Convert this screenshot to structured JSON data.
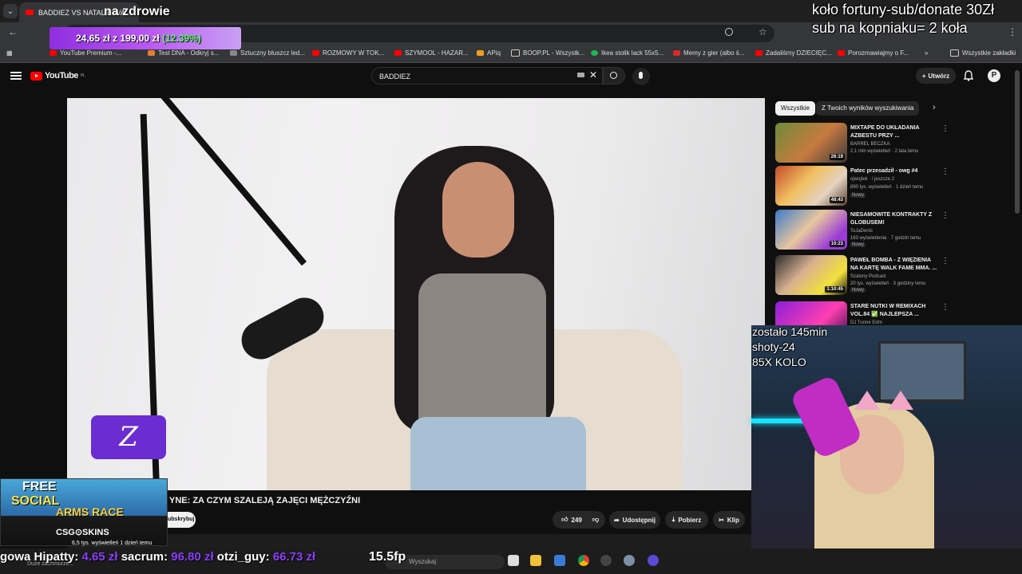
{
  "browser": {
    "tab_title": "BADDIEZ VS NATALIE WAKOWSKA - YouTube",
    "tab_visible": "BADDIEZ VS NATALIE WA",
    "bookmarks": [
      "YouTube Premium -...",
      "Test DNA - Odkryj s...",
      "Sztuczny bluszcz led...",
      "ROZMOWY W TOK...",
      "SZYMOOL - HAZAR...",
      "APiq",
      "BOOP.PL - Wszystk...",
      "Ikea stolik lack 55x5...",
      "Memy z gier (albo ś...",
      "Zadaliśmy DZIECIĘC...",
      "Porozmawiajmy o F..."
    ],
    "all_bookmarks": "Wszystkie zakładki"
  },
  "youtube": {
    "logo": "YouTube",
    "region": "PL",
    "search_value": "BADDIEZ",
    "create_label": "Utwórz",
    "avatar_letter": "P"
  },
  "video": {
    "title": "YNE: ZA CZYM SZALEJĄ ZAJĘCI MĘŻCZYŹNI",
    "subscribe": "ubskrybuj",
    "likes": "249",
    "share": "Udostępnij",
    "download": "Pobierz",
    "clip": "Klip",
    "views": "6,5 tys. wyświetleń  1 dzień temu",
    "desc_hint": "Duże zachmurze..."
  },
  "sidebar": {
    "chips": [
      "Wszystkie",
      "Z Twoich wyników wyszukiwania"
    ],
    "recommendations": [
      {
        "title": "MIXTAPE DO UKŁADANIA AZBESTU PRZY ...",
        "channel": "BARREL BECZKA",
        "meta": "2,1 mln wyświetleń · 2 lata temu",
        "duration": "26:19",
        "new": ""
      },
      {
        "title": "Patec przesadził - owg #4",
        "channel": "ojwojtek · i jeszcze 2",
        "meta": "890 tys. wyświetleń · 1 dzień temu",
        "duration": "48:43",
        "new": "Nowy"
      },
      {
        "title": "NIESAMOWITE KONTRAKTY Z GLOBUSEM!",
        "channel": "ToJaDenis",
        "meta": "163 wyświetlenia · 7 godzin temu",
        "duration": "10:23",
        "new": "Nowy"
      },
      {
        "title": "PAWEŁ BOMBA - Z WIĘZIENIA NA KARTĘ WALK FAME MMA. ...",
        "channel": "Szalony Podcast",
        "meta": "20 tys. wyświetleń · 3 godziny temu",
        "duration": "1:10:45",
        "new": "Nowy"
      },
      {
        "title": "STARE NUTKI W REMIXACH VOL.84 ✅ NAJLEPSZA ...",
        "channel": "DJ Tunne Edm",
        "meta": "",
        "duration": "",
        "new": ""
      }
    ]
  },
  "overlay": {
    "top": "na zdrowie",
    "right_line1": "koło fortuny-sub/donate 30Zł",
    "right_line2": "sub na kopniaku= 2 koła",
    "goal_current": "24,65 zł",
    "goal_sep": "z",
    "goal_target": "199,00 zł",
    "goal_pct": "(12.39%)",
    "cam_line1": "zostało 145min",
    "cam_line2": "shoty-24",
    "cam_line3": "85X KOLO",
    "ad_free": "FREE",
    "ad_social": "SOCIAL",
    "ad_arms": "ARMS RACE",
    "ad_brand": "CSG⊙SKINS",
    "ticker": [
      {
        "name": "gowa Hipatty:",
        "amount": "4.65 zł"
      },
      {
        "name": "sacrum:",
        "amount": "96.80 zł"
      },
      {
        "name": "otzi_guy:",
        "amount": "66.73 zł"
      }
    ],
    "fps": "15.5fp",
    "taskbar_search": "Wyszukaj"
  }
}
